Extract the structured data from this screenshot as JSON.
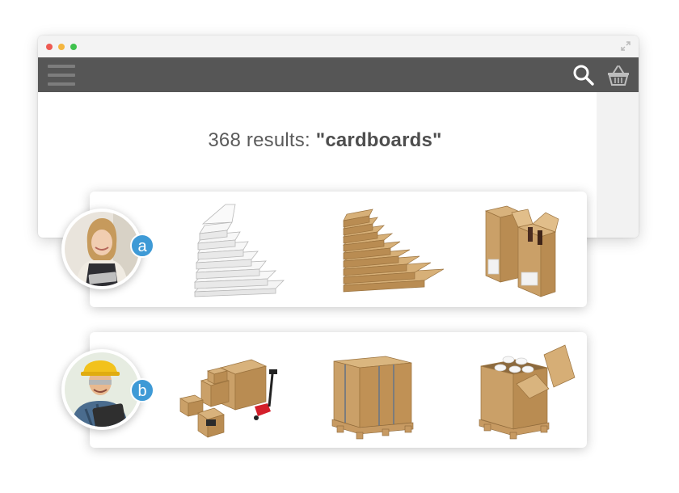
{
  "window": {
    "controls": [
      "close",
      "minimize",
      "maximize"
    ],
    "expand_icon": "expand-icon"
  },
  "appbar": {
    "menu_icon": "hamburger-menu-icon",
    "search_icon": "search-icon",
    "cart_icon": "shopping-basket-icon",
    "background": "#565656"
  },
  "search": {
    "count": "368",
    "label": " results: ",
    "query": "\"cardboards\""
  },
  "personas": [
    {
      "badge": "a",
      "avatar": "shop-owner-woman-with-tablet",
      "products": [
        "white-flat-boxes-stack",
        "brown-flat-boxes-stack",
        "bottle-shipping-boxes"
      ]
    },
    {
      "badge": "b",
      "avatar": "warehouse-worker-with-hard-hat-and-tablet",
      "products": [
        "boxes-with-pallet-jack",
        "strapped-pallet-box",
        "open-pallet-box-with-rolls"
      ]
    }
  ],
  "colors": {
    "badge": "#3e9ad6",
    "cardboard": "#c9a06a"
  }
}
